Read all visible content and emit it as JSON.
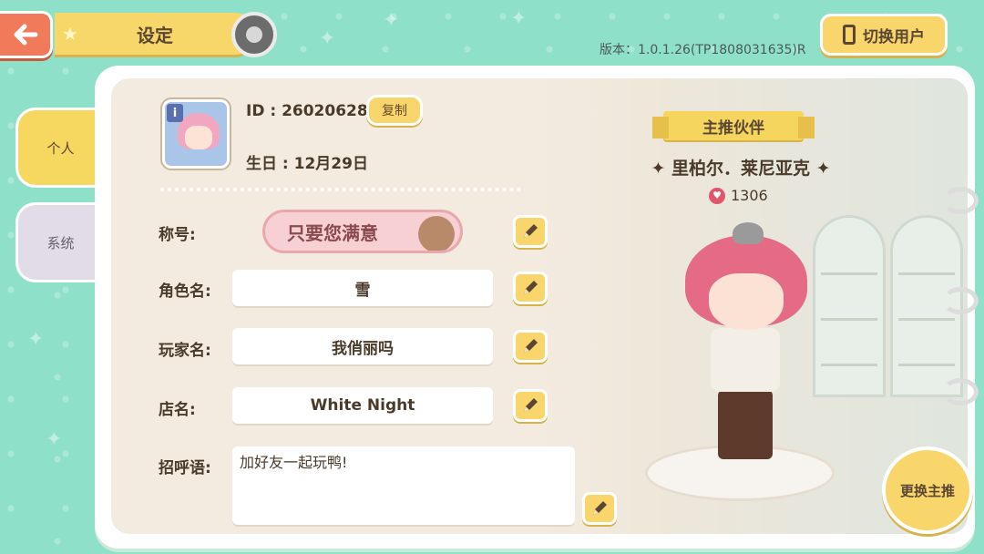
{
  "header": {
    "title": "设定",
    "version": "版本：1.0.1.26(TP1808031635)R",
    "switch_user_label": "切换用户"
  },
  "tabs": [
    {
      "label": "个人",
      "active": true
    },
    {
      "label": "系统",
      "active": false
    }
  ],
  "profile": {
    "id_text": "ID : 26020628",
    "copy_label": "复制",
    "birthday_text": "生日 : 12月29日",
    "fields": {
      "title_label": "称号:",
      "title_value": "只要您满意",
      "role_label": "角色名:",
      "role_value": "雪",
      "player_label": "玩家名:",
      "player_value": "我俏丽吗",
      "shop_label": "店名:",
      "shop_value": "White Night",
      "greeting_label": "招呼语:",
      "greeting_value": "加好友一起玩鸭!"
    }
  },
  "partner": {
    "ribbon_label": "主推伙伴",
    "name": "里柏尔．莱尼亚克",
    "affection": "1306",
    "change_label": "更换主推"
  },
  "icons": {
    "back": "back-arrow-icon",
    "settings": "gear-icon",
    "phone": "phone-icon",
    "edit": "pencil-icon",
    "heart": "heart-icon"
  }
}
